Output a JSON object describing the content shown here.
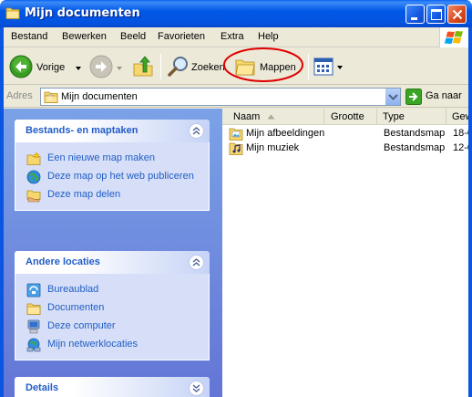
{
  "window": {
    "title": "Mijn documenten"
  },
  "menu": {
    "items": [
      {
        "label": "Bestand"
      },
      {
        "label": "Bewerken"
      },
      {
        "label": "Beeld"
      },
      {
        "label": "Favorieten"
      },
      {
        "label": "Extra"
      },
      {
        "label": "Help"
      }
    ]
  },
  "toolbar": {
    "back_label": "Vorige",
    "search_label": "Zoeken",
    "folders_label": "Mappen"
  },
  "address": {
    "label": "Adres",
    "value": "Mijn documenten",
    "go_label": "Ga naar"
  },
  "taskpane": {
    "file_tasks": {
      "title": "Bestands- en maptaken",
      "items": [
        {
          "label": "Een nieuwe map maken",
          "icon": "new-folder-icon"
        },
        {
          "label": "Deze map op het web publiceren",
          "icon": "globe-icon"
        },
        {
          "label": "Deze map delen",
          "icon": "share-folder-icon"
        }
      ]
    },
    "other_places": {
      "title": "Andere locaties",
      "items": [
        {
          "label": "Bureaublad",
          "icon": "desktop-icon"
        },
        {
          "label": "Documenten",
          "icon": "folder-icon"
        },
        {
          "label": "Deze computer",
          "icon": "computer-icon"
        },
        {
          "label": "Mijn netwerklocaties",
          "icon": "network-icon"
        }
      ]
    },
    "details": {
      "title": "Details"
    }
  },
  "filelist": {
    "columns": [
      {
        "label": "Naam"
      },
      {
        "label": "Grootte"
      },
      {
        "label": "Type"
      },
      {
        "label": "Gew"
      }
    ],
    "rows": [
      {
        "name": "Mijn afbeeldingen",
        "size": "",
        "type": "Bestandsmap",
        "modified": "18-0"
      },
      {
        "name": "Mijn muziek",
        "size": "",
        "type": "Bestandsmap",
        "modified": "12-0"
      }
    ]
  },
  "colors": {
    "titlebar": "#0058e6",
    "taskpane_link": "#215dc6",
    "highlight_circle": "#e00000"
  }
}
